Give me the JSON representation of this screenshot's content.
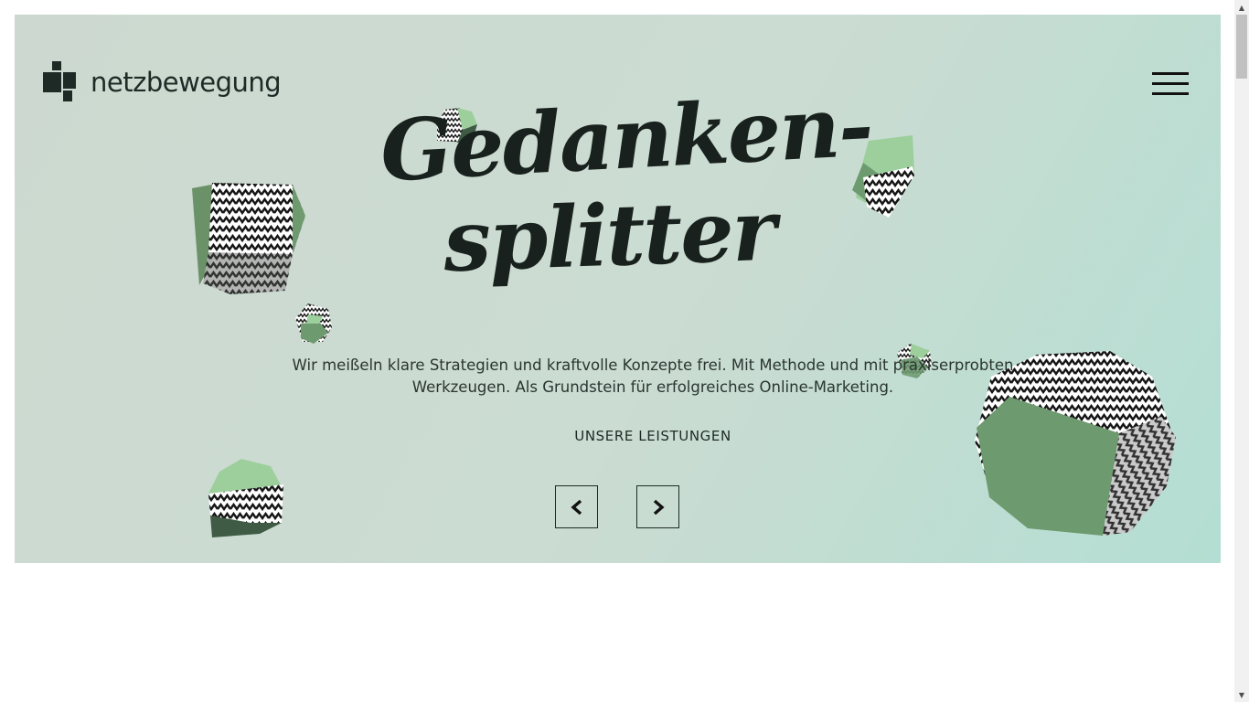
{
  "brand": {
    "name": "netzbewegung"
  },
  "header": {
    "menu_icon": "hamburger-menu-icon"
  },
  "hero": {
    "headline_line1": "Gedanken-",
    "headline_line2": "splitter",
    "intro_line1": "Wir meißeln klare Strategien und kraftvolle Konzepte frei. Mit Methode und mit praxiserprobten",
    "intro_line2": "Werkzeugen. Als Grundstein für erfolgreiches Online-Marketing.",
    "cta_label": "UNSERE LEISTUNGEN",
    "prev_icon": "chevron-left-icon",
    "next_icon": "chevron-right-icon"
  },
  "colors": {
    "hero_bg_start": "#cdd9d0",
    "hero_bg_end": "#b4ded3",
    "text_dark": "#1e2a26",
    "rock_green": "#6e9a70",
    "rock_light_green": "#9ccf9c",
    "rock_dark_green": "#3f5b45"
  }
}
